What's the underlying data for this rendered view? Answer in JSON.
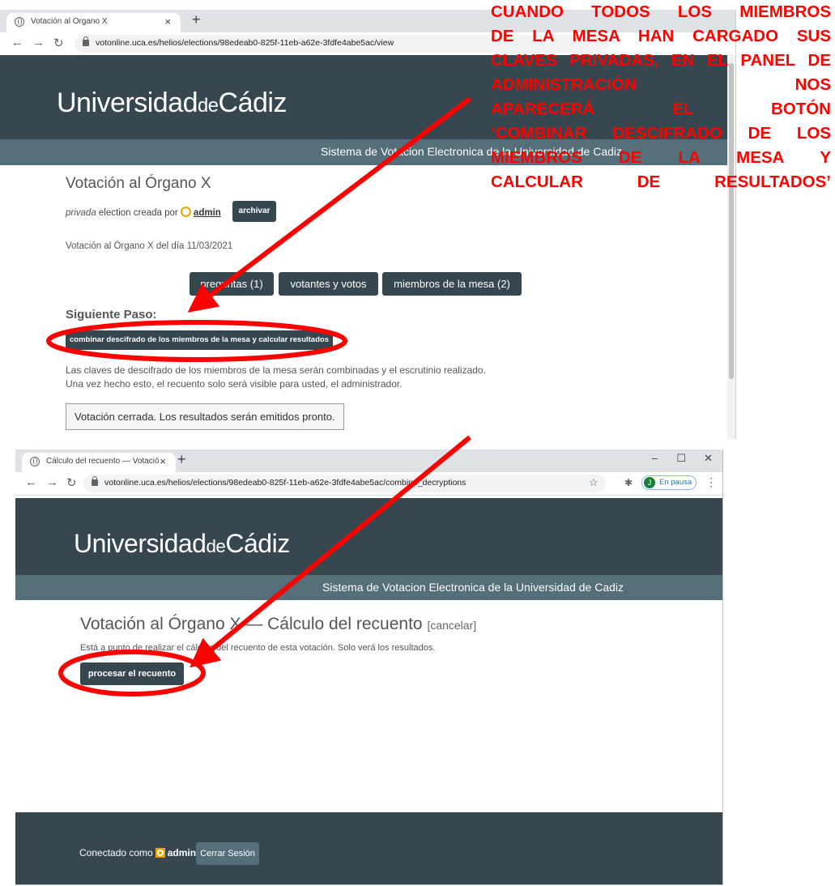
{
  "screenshot1": {
    "tab_title": "Votación al Órgano X",
    "tab_close": "×",
    "new_tab": "+",
    "url": "votonline.uca.es/helios/elections/98edeab0-825f-11eb-a62e-3fdfe4abe5ac/view",
    "logo_main": "Universidad",
    "logo_small": "de",
    "logo_end": "Cádiz",
    "subtitle": "Sistema de Votacion Electronica de la Universidad de Cadiz",
    "election_title": "Votación al Órgano X",
    "privacy": "privada",
    "created_by": " election creada por ",
    "admin": "admin",
    "archive_button": "archivar",
    "description": "Votación al Órgano X del día 11/03/2021",
    "tabs": [
      "preguntas (1)",
      "votantes y votos",
      "miembros de la mesa (2)"
    ],
    "next_step_label": "Siguiente Paso:",
    "combine_button": "combinar descifrado de los miembros de la mesa y calcular resultados",
    "info_line1": "Las claves de descifrado de los miembros de la mesa serán combinadas y el escrutinio realizado.",
    "info_line2": "Una vez hecho esto, el recuento solo será visible para usted, el administrador.",
    "status": "Votación cerrada. Los resultados serán emitidos pronto."
  },
  "screenshot2": {
    "tab_title": "Cálculo del recuento — Votación",
    "tab_close": "×",
    "new_tab": "+",
    "window_controls": [
      "–",
      "☐",
      "✕"
    ],
    "url": "votonline.uca.es/helios/elections/98edeab0-825f-11eb-a62e-3fdfe4abe5ac/combine_decryptions",
    "profile_initial": "J",
    "profile_label": "En pausa",
    "logo_main": "Universidad",
    "logo_small": "de",
    "logo_end": "Cádiz",
    "subtitle": "Sistema de Votacion Electronica de la Universidad de Cadiz",
    "page_title": "Votación al Órgano X — Cálculo del recuento",
    "cancel_link": "[cancelar]",
    "instruction": "Está a punto de realizar el cálculo del recuento de esta votación. Solo verá los resultados.",
    "process_button": "procesar el recuento",
    "footer_connected": "Conectado como",
    "footer_admin": "admin",
    "logout_button": "Cerrar Sesión"
  },
  "annotation": {
    "text": "CUANDO TODOS LOS MIEMBROS\nDE LA MESA HAN CARGADO SUS\nCLAVES PRIVADAS, EN EL PANEL DE\nADMINISTRACIÓN NOS\nAPARECERÁ EL BOTÓN\n‘COMBINAR DESCIFRADO DE LOS\nMIEMBROS DE LA MESA Y\nCALCULAR DE RESULTADOS’",
    "color": "#ff0000"
  }
}
